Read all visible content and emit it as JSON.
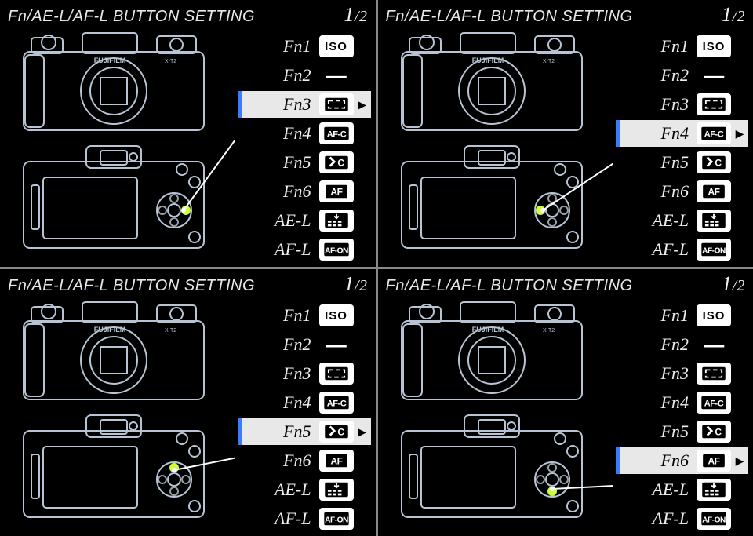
{
  "title": "Fn/AE-L/AF-L BUTTON SETTING",
  "page_current": "1",
  "page_total": "/2",
  "rows": [
    {
      "label": "Fn1",
      "icon": "ISO"
    },
    {
      "label": "Fn2",
      "icon": "NONE"
    },
    {
      "label": "Fn3",
      "icon": "AFAREA"
    },
    {
      "label": "Fn4",
      "icon": "AF-C"
    },
    {
      "label": "Fn5",
      "icon": "BKT-C"
    },
    {
      "label": "Fn6",
      "icon": "AF"
    },
    {
      "label": "AE-L",
      "icon": "BKT"
    },
    {
      "label": "AF-L",
      "icon": "AF-ON"
    }
  ],
  "quadrants": [
    {
      "selected_index": 2,
      "highlight": "right"
    },
    {
      "selected_index": 3,
      "highlight": "left"
    },
    {
      "selected_index": 4,
      "highlight": "up"
    },
    {
      "selected_index": 5,
      "highlight": "down"
    }
  ]
}
